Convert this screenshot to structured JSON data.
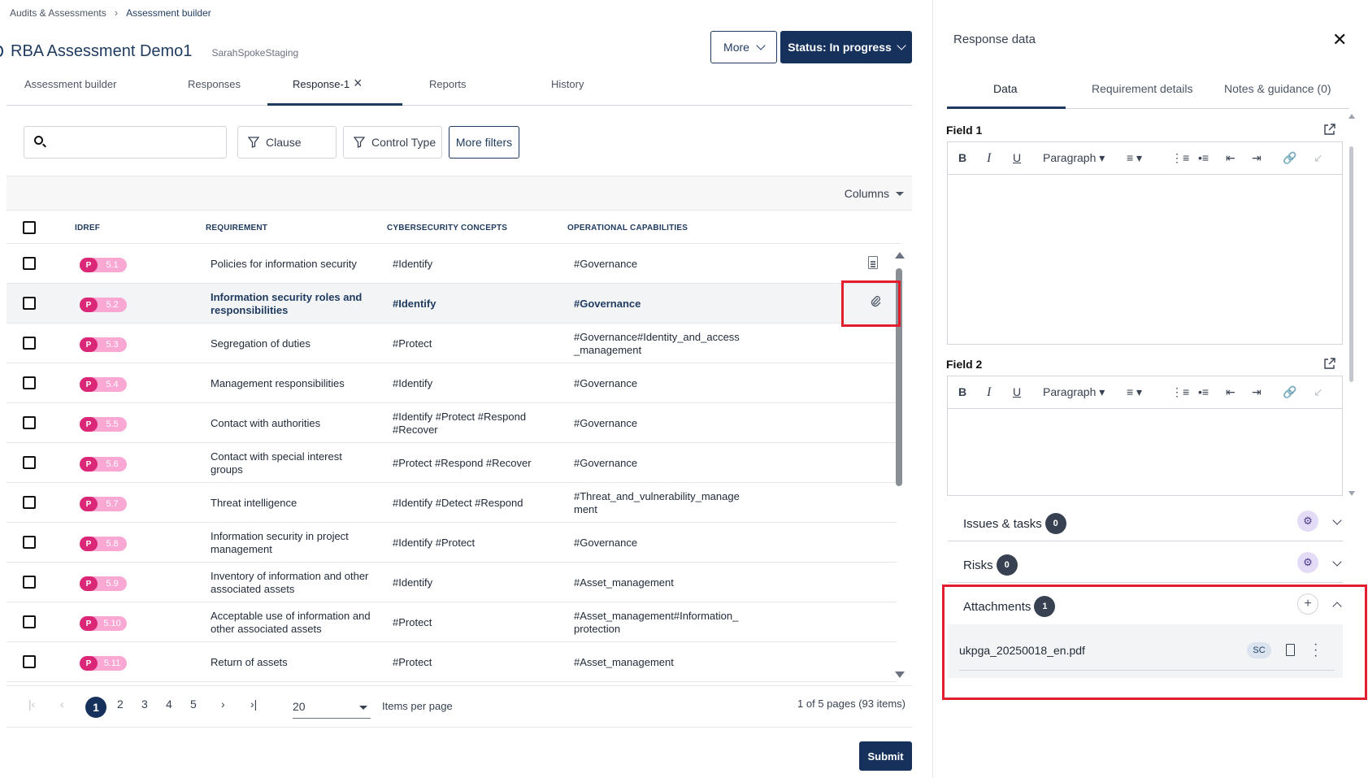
{
  "breadcrumb": {
    "parent": "Audits & Assessments",
    "current": "Assessment builder"
  },
  "header": {
    "title": "RBA Assessment Demo1",
    "org": "SarahSpokeStaging",
    "more_label": "More",
    "status_label": "Status: In progress"
  },
  "tabs": [
    {
      "label": "Assessment builder"
    },
    {
      "label": "Responses"
    },
    {
      "label": "Response-1"
    },
    {
      "label": "Reports"
    },
    {
      "label": "History"
    }
  ],
  "filters": {
    "search_placeholder": "",
    "clause": "Clause",
    "control_type": "Control Type",
    "more_filters": "More filters"
  },
  "table": {
    "columns_label": "Columns",
    "headers": {
      "idref": "IDREF",
      "requirement": "REQUIREMENT",
      "concepts": "CYBERSECURITY CONCEPTS",
      "capabilities": "OPERATIONAL CAPABILITIES"
    },
    "rows": [
      {
        "badge": "P",
        "id": "5.1",
        "req": "Policies for information security",
        "concepts": "#Identify",
        "caps": "#Governance"
      },
      {
        "badge": "P",
        "id": "5.2",
        "req": "Information security roles and responsibilities",
        "concepts": "#Identify",
        "caps": "#Governance"
      },
      {
        "badge": "P",
        "id": "5.3",
        "req": "Segregation of duties",
        "concepts": "#Protect",
        "caps": "#Governance#Identity_and_access _management"
      },
      {
        "badge": "P",
        "id": "5.4",
        "req": "Management responsibilities",
        "concepts": "#Identify",
        "caps": "#Governance"
      },
      {
        "badge": "P",
        "id": "5.5",
        "req": "Contact with authorities",
        "concepts": "#Identify #Protect #Respond #Recover",
        "caps": "#Governance"
      },
      {
        "badge": "P",
        "id": "5.6",
        "req": "Contact with special interest groups",
        "concepts": "#Protect #Respond #Recover",
        "caps": "#Governance"
      },
      {
        "badge": "P",
        "id": "5.7",
        "req": "Threat intelligence",
        "concepts": "#Identify #Detect #Respond",
        "caps": "#Threat_and_vulnerability_manage ment"
      },
      {
        "badge": "P",
        "id": "5.8",
        "req": "Information security in project management",
        "concepts": "#Identify #Protect",
        "caps": "#Governance"
      },
      {
        "badge": "P",
        "id": "5.9",
        "req": "Inventory of information and other associated assets",
        "concepts": "#Identify",
        "caps": "#Asset_management"
      },
      {
        "badge": "P",
        "id": "5.10",
        "req": "Acceptable use of information and other associated assets",
        "concepts": "#Protect",
        "caps": "#Asset_management#Information_ protection"
      },
      {
        "badge": "P",
        "id": "5.11",
        "req": "Return of assets",
        "concepts": "#Protect",
        "caps": "#Asset_management"
      }
    ]
  },
  "pagination": {
    "pages": [
      "1",
      "2",
      "3",
      "4",
      "5"
    ],
    "items_per_page": "20",
    "items_per_page_label": "Items per page",
    "summary": "1 of 5 pages (93 items)"
  },
  "submit_label": "Submit",
  "panel": {
    "title": "Response data",
    "tabs": [
      {
        "label": "Data"
      },
      {
        "label": "Requirement details"
      },
      {
        "label": "Notes & guidance (0)"
      }
    ],
    "field1_label": "Field 1",
    "field2_label": "Field 2",
    "editor_format": "Paragraph",
    "issues_label": "Issues & tasks",
    "issues_count": "0",
    "risks_label": "Risks",
    "risks_count": "0",
    "attachments_label": "Attachments",
    "attachments_count": "1",
    "attachment": {
      "name": "ukpga_20250018_en.pdf",
      "badge": "SC"
    }
  },
  "colors": {
    "primary": "#16325c",
    "highlight": "#e11d2e",
    "badge_pink": "#db2777"
  }
}
